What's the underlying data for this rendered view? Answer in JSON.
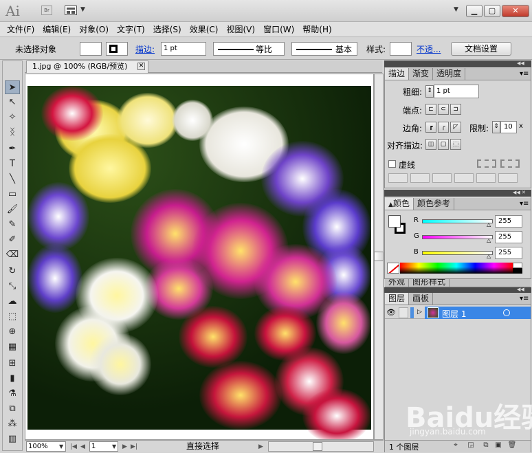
{
  "titlebar": {
    "logo": "Ai",
    "bridge": "Br",
    "window_buttons": [
      "▁",
      "▢",
      "✕"
    ]
  },
  "menu": [
    "文件(F)",
    "编辑(E)",
    "对象(O)",
    "文字(T)",
    "选择(S)",
    "效果(C)",
    "视图(V)",
    "窗口(W)",
    "帮助(H)"
  ],
  "control": {
    "selection": "未选择对象",
    "stroke_label": "描边:",
    "stroke_weight": "1 pt",
    "profile": "等比",
    "brush": "基本",
    "style_label": "样式:",
    "opacity_label": "不透...",
    "doc_setup": "文档设置"
  },
  "document": {
    "tab": "1.jpg @ 100% (RGB/预览)",
    "close": "✕"
  },
  "status": {
    "zoom": "100%",
    "page": "1",
    "tool": "直接选择"
  },
  "stroke_panel": {
    "tabs": [
      "描边",
      "渐变",
      "透明度"
    ],
    "weight_label": "粗细:",
    "weight_value": "1 pt",
    "cap_label": "端点:",
    "join_label": "边角:",
    "limit_label": "限制:",
    "limit_value": "10",
    "limit_unit": "x",
    "align_label": "对齐描边:",
    "dash_label": "虚线"
  },
  "color_panel": {
    "tabs": [
      "颜色",
      "颜色参考"
    ],
    "channels": [
      {
        "name": "R",
        "value": "255"
      },
      {
        "name": "G",
        "value": "255"
      },
      {
        "name": "B",
        "value": "255"
      }
    ]
  },
  "appearance_tabs": [
    "外观",
    "图形样式"
  ],
  "layers_panel": {
    "tabs": [
      "图层",
      "画板"
    ],
    "layer_name": "图层 1",
    "layer_count": "1 个图层"
  },
  "watermark": {
    "brand": "Baidu经验",
    "url": "jingyan.baidu.com"
  }
}
